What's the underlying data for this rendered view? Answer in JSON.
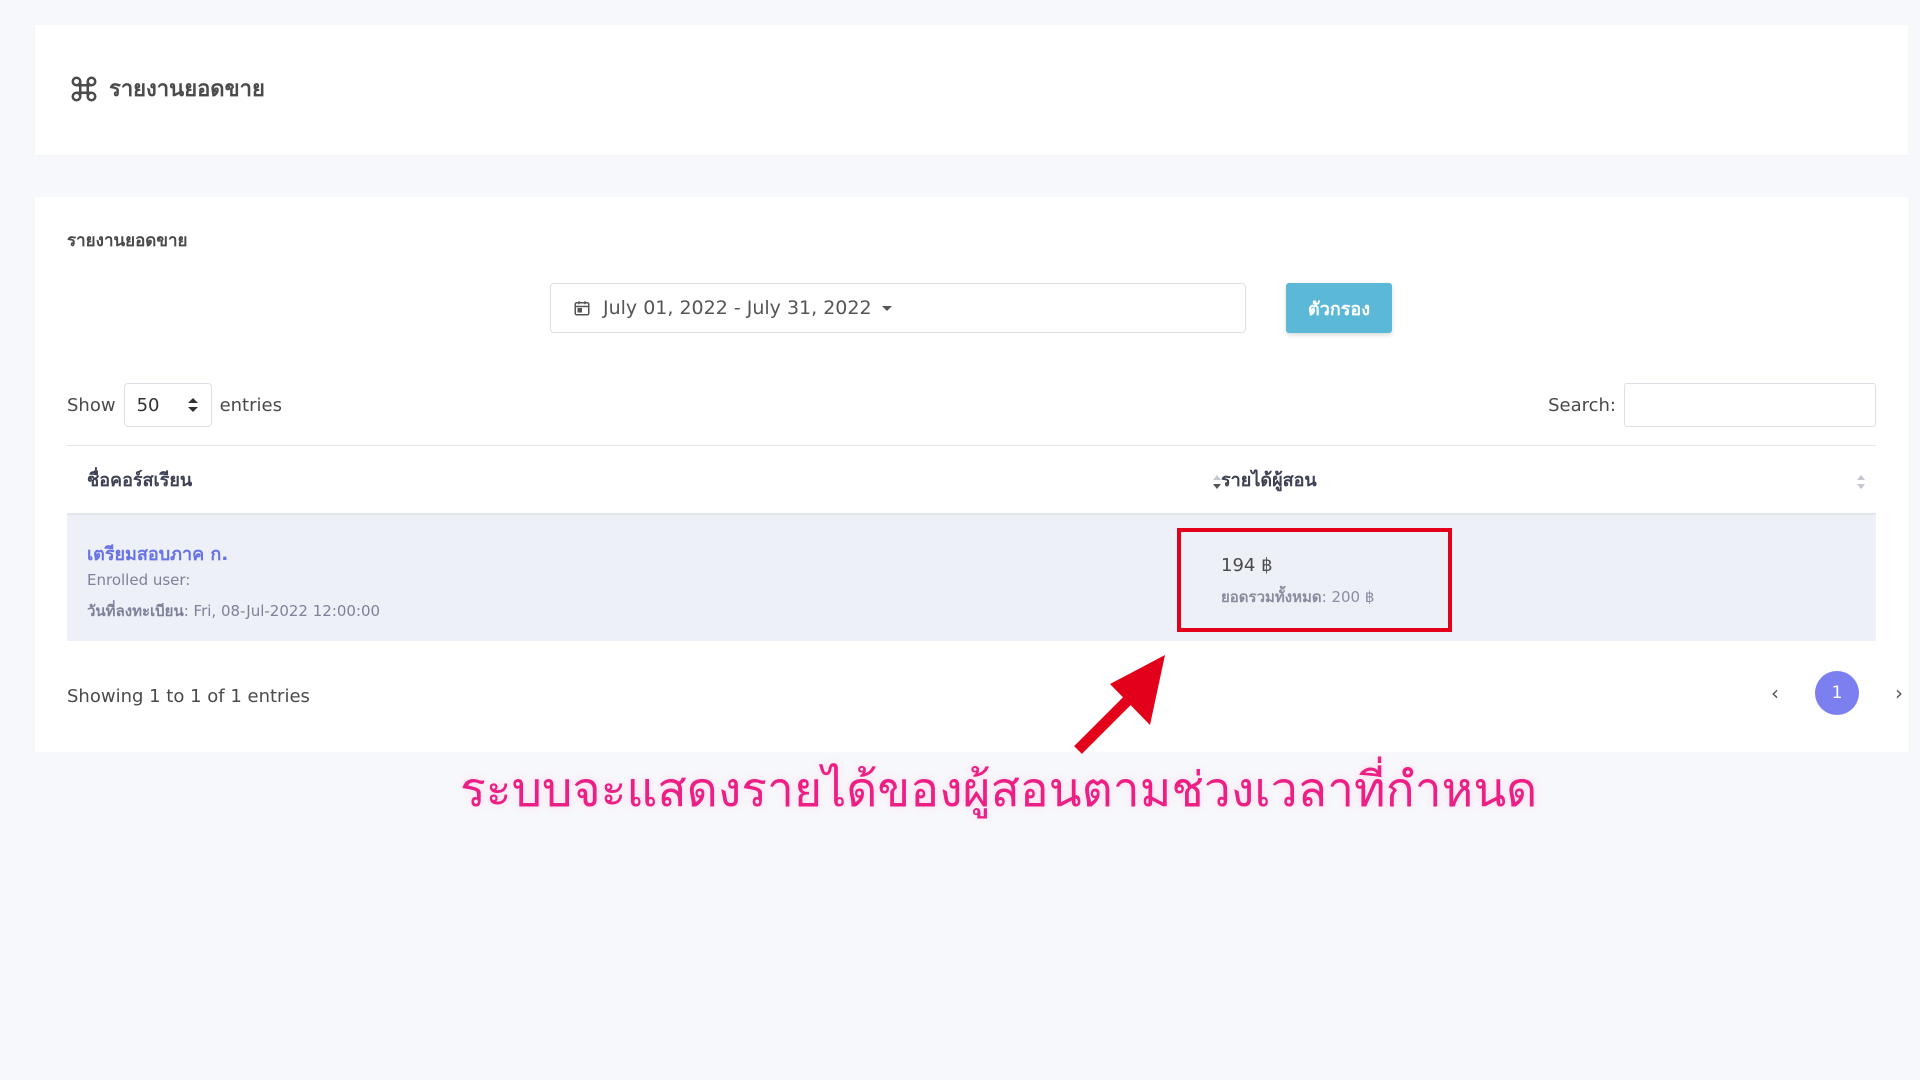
{
  "header": {
    "title": "รายงานยอดขาย",
    "icon": "command-icon"
  },
  "report": {
    "title": "รายงานยอดขาย",
    "date_range": "July 01, 2022 - July 31, 2022",
    "filter_label": "ตัวกรอง"
  },
  "table_controls": {
    "show_label": "Show",
    "entries_value": "50",
    "entries_label": "entries",
    "search_label": "Search:"
  },
  "table": {
    "headers": [
      "ชื่อคอร์สเรียน",
      "รายได้ผู้สอน"
    ],
    "rows": [
      {
        "course": "เตรียมสอบภาค ก.",
        "enrolled": "Enrolled user:",
        "reg_label": "วันที่ลงทะเบียน",
        "reg_value": ": Fri, 08-Jul-2022 12:00:00",
        "income": "194 ฿",
        "total_label": "ยอดรวมทั้งหมด",
        "total_value": ": 200 ฿"
      }
    ]
  },
  "footer": {
    "info": "Showing 1 to 1 of 1 entries",
    "prev": "‹",
    "current_page": "1",
    "next": "›"
  },
  "annotation": {
    "caption": "ระบบจะแสดงรายได้ของผู้สอนตามช่วงเวลาที่กำหนด",
    "highlight_color": "#e3001b",
    "caption_color": "#ec1f85"
  },
  "colors": {
    "filter_button": "#5bb8d6",
    "link": "#6772e5",
    "pagination_active": "#7b7ff0",
    "row_bg": "#eef0f8"
  }
}
